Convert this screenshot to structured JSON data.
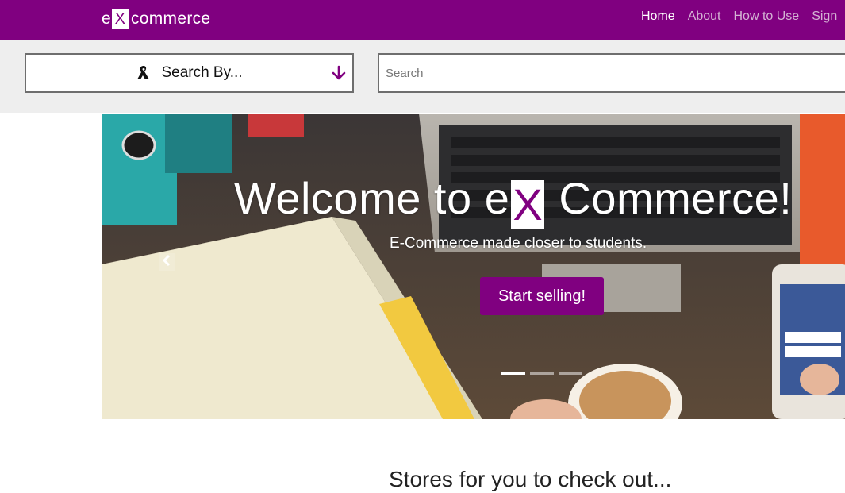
{
  "brand": {
    "prefix": "e",
    "x": "X",
    "suffix": "commerce"
  },
  "nav": {
    "items": [
      "Home",
      "About",
      "How to Use",
      "Sign"
    ],
    "active": "Home"
  },
  "search": {
    "by_label": "Search By...",
    "placeholder": "Search",
    "value": ""
  },
  "hero": {
    "title_before": "Welcome to e",
    "title_x": "X",
    "title_after": " Commerce!",
    "subtitle": "E-Commerce made closer to students.",
    "cta": "Start selling!",
    "slides": 3,
    "active_slide": 1
  },
  "stores": {
    "heading": "Stores for you to check out..."
  },
  "colors": {
    "brand": "#800080",
    "searchbar_bg": "#eeeeee"
  },
  "icons": [
    "ribbon-icon",
    "arrow-down-icon",
    "chevron-left-icon"
  ]
}
